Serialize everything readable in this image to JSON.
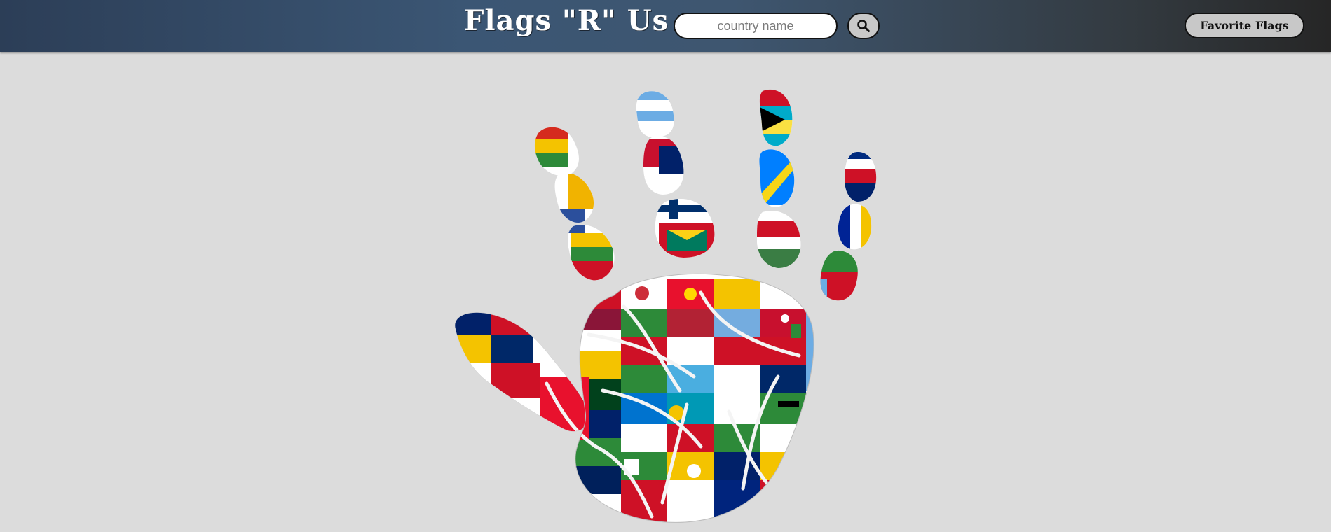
{
  "header": {
    "brand": "Flags \"R\" Us",
    "search_placeholder": "country name",
    "search_icon": "search-icon",
    "favorites_label": "Favorite Flags"
  },
  "colors": {
    "header_dark": "#2c3e57",
    "header_right": "#262626",
    "page_background": "#dcdcdc",
    "button_gray": "#c8c8c8"
  },
  "hero": {
    "image": "handprint-of-world-flags"
  }
}
